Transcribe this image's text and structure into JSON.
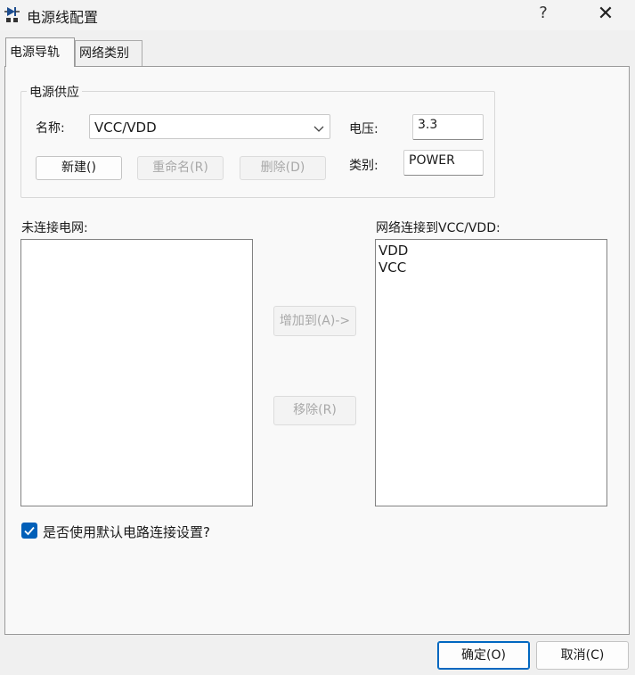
{
  "window": {
    "title": "电源线配置",
    "help": "?",
    "close": "✕"
  },
  "tabs": [
    {
      "label": "电源导轨",
      "active": true
    },
    {
      "label": "网络类别",
      "active": false
    }
  ],
  "power_supply": {
    "group_title": "电源供应",
    "name_label": "名称:",
    "name_value": "VCC/VDD",
    "voltage_label": "电压:",
    "voltage_value": "3.3",
    "category_label": "类别:",
    "category_value": "POWER",
    "new_button": "新建()",
    "rename_button": "重命名(R)",
    "delete_button": "删除(D)"
  },
  "unconnected": {
    "label": "未连接电网:",
    "items": []
  },
  "connected": {
    "label": "网络连接到VCC/VDD:",
    "items": [
      "VDD",
      "VCC"
    ]
  },
  "transfer": {
    "add_button": "增加到(A)->",
    "remove_button": "移除(R)"
  },
  "default_settings": {
    "label": "是否使用默认电路连接设置?",
    "checked": true
  },
  "footer": {
    "ok_button": "确定(O)",
    "cancel_button": "取消(C)"
  },
  "colors": {
    "accent": "#005fb8",
    "primary_border": "#0067c0",
    "disabled_text": "#a8a8a8"
  }
}
